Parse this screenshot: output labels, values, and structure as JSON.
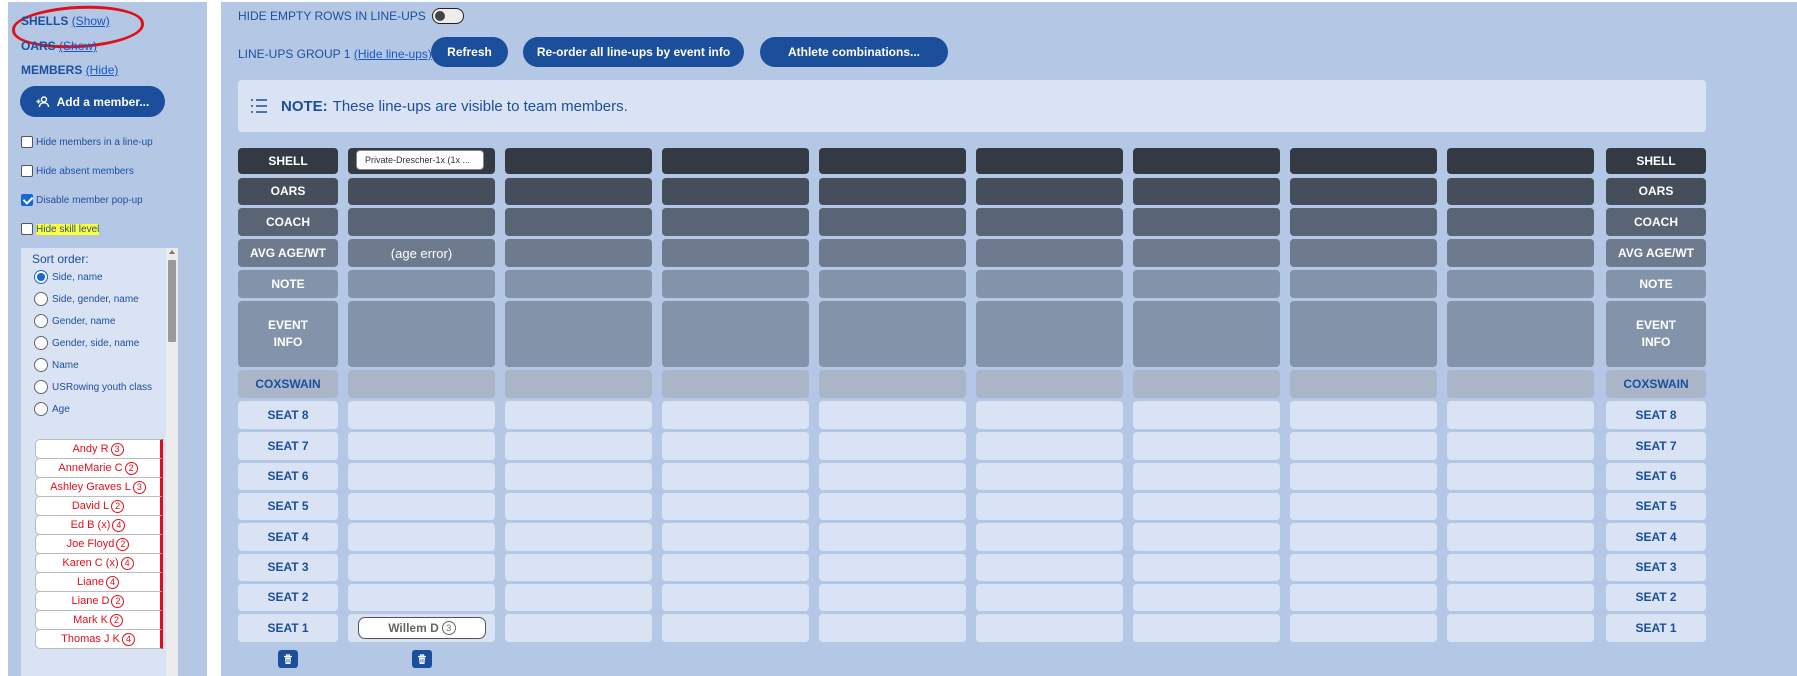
{
  "sidebar": {
    "shells": {
      "label": "SHELLS",
      "toggle": "(Show)"
    },
    "oars": {
      "label": "OARS",
      "toggle": "(Show)"
    },
    "members": {
      "label": "MEMBERS",
      "toggle": "(Hide)"
    },
    "add_member_label": "Add a member...",
    "options": [
      {
        "label": "Hide members in a line-up",
        "checked": false
      },
      {
        "label": "Hide absent members",
        "checked": false
      },
      {
        "label": "Disable member pop-up",
        "checked": true
      },
      {
        "label": "Hide skill level",
        "checked": false,
        "highlighted": true
      }
    ],
    "sort": {
      "title": "Sort order:",
      "options": [
        "Side, name",
        "Side, gender, name",
        "Gender, name",
        "Gender, side, name",
        "Name",
        "USRowing youth class",
        "Age"
      ],
      "selected": "Side, name"
    },
    "member_list": [
      {
        "name": "Andy R",
        "skill": "3"
      },
      {
        "name": "AnneMarie C",
        "skill": "2"
      },
      {
        "name": "Ashley Graves L",
        "skill": "3"
      },
      {
        "name": "David L",
        "skill": "2"
      },
      {
        "name": "Ed B (x)",
        "skill": "4"
      },
      {
        "name": "Joe Floyd",
        "skill": "2"
      },
      {
        "name": "Karen C (x)",
        "skill": "4"
      },
      {
        "name": "Liane",
        "skill": "4"
      },
      {
        "name": "Liane D",
        "skill": "2"
      },
      {
        "name": "Mark K",
        "skill": "2"
      },
      {
        "name": "Thomas J K",
        "skill": "4"
      }
    ],
    "annotation_color": "#e0101a"
  },
  "main": {
    "hide_empty_label": "HIDE EMPTY ROWS IN LINE-UPS",
    "hide_empty_on": false,
    "group_label": "LINE-UPS GROUP 1",
    "group_toggle": "(Hide line-ups)",
    "buttons": {
      "refresh": "Refresh",
      "reorder": "Re-order all line-ups by event info",
      "athletes": "Athlete combinations..."
    },
    "note": {
      "bold": "NOTE:",
      "text": "These line-ups are visible to team members."
    },
    "row_labels": [
      "SHELL",
      "OARS",
      "COACH",
      "AVG AGE/WT",
      "NOTE",
      "EVENT INFO",
      "COXSWAIN",
      "SEAT 8",
      "SEAT 7",
      "SEAT 6",
      "SEAT 5",
      "SEAT 4",
      "SEAT 3",
      "SEAT 2",
      "SEAT 1"
    ],
    "lineup_count": 8,
    "lineup1": {
      "shell_value": "Private-Drescher-1x (1x ...",
      "avg_age": "(age error)",
      "seat1_member": "Willem D",
      "seat1_skill": "3"
    }
  },
  "colors": {
    "brand": "#1b4f9c",
    "sidebar_bg": "#b4c8e6",
    "panel_bg": "#dae3f3",
    "row_shell": "#343a44",
    "row_oars": "#464e5c",
    "row_coach": "#596475",
    "row_age": "#6e7b8f",
    "row_note": "#8393aa",
    "row_cox": "#aab6c8",
    "row_seat": "#dae3f3"
  }
}
